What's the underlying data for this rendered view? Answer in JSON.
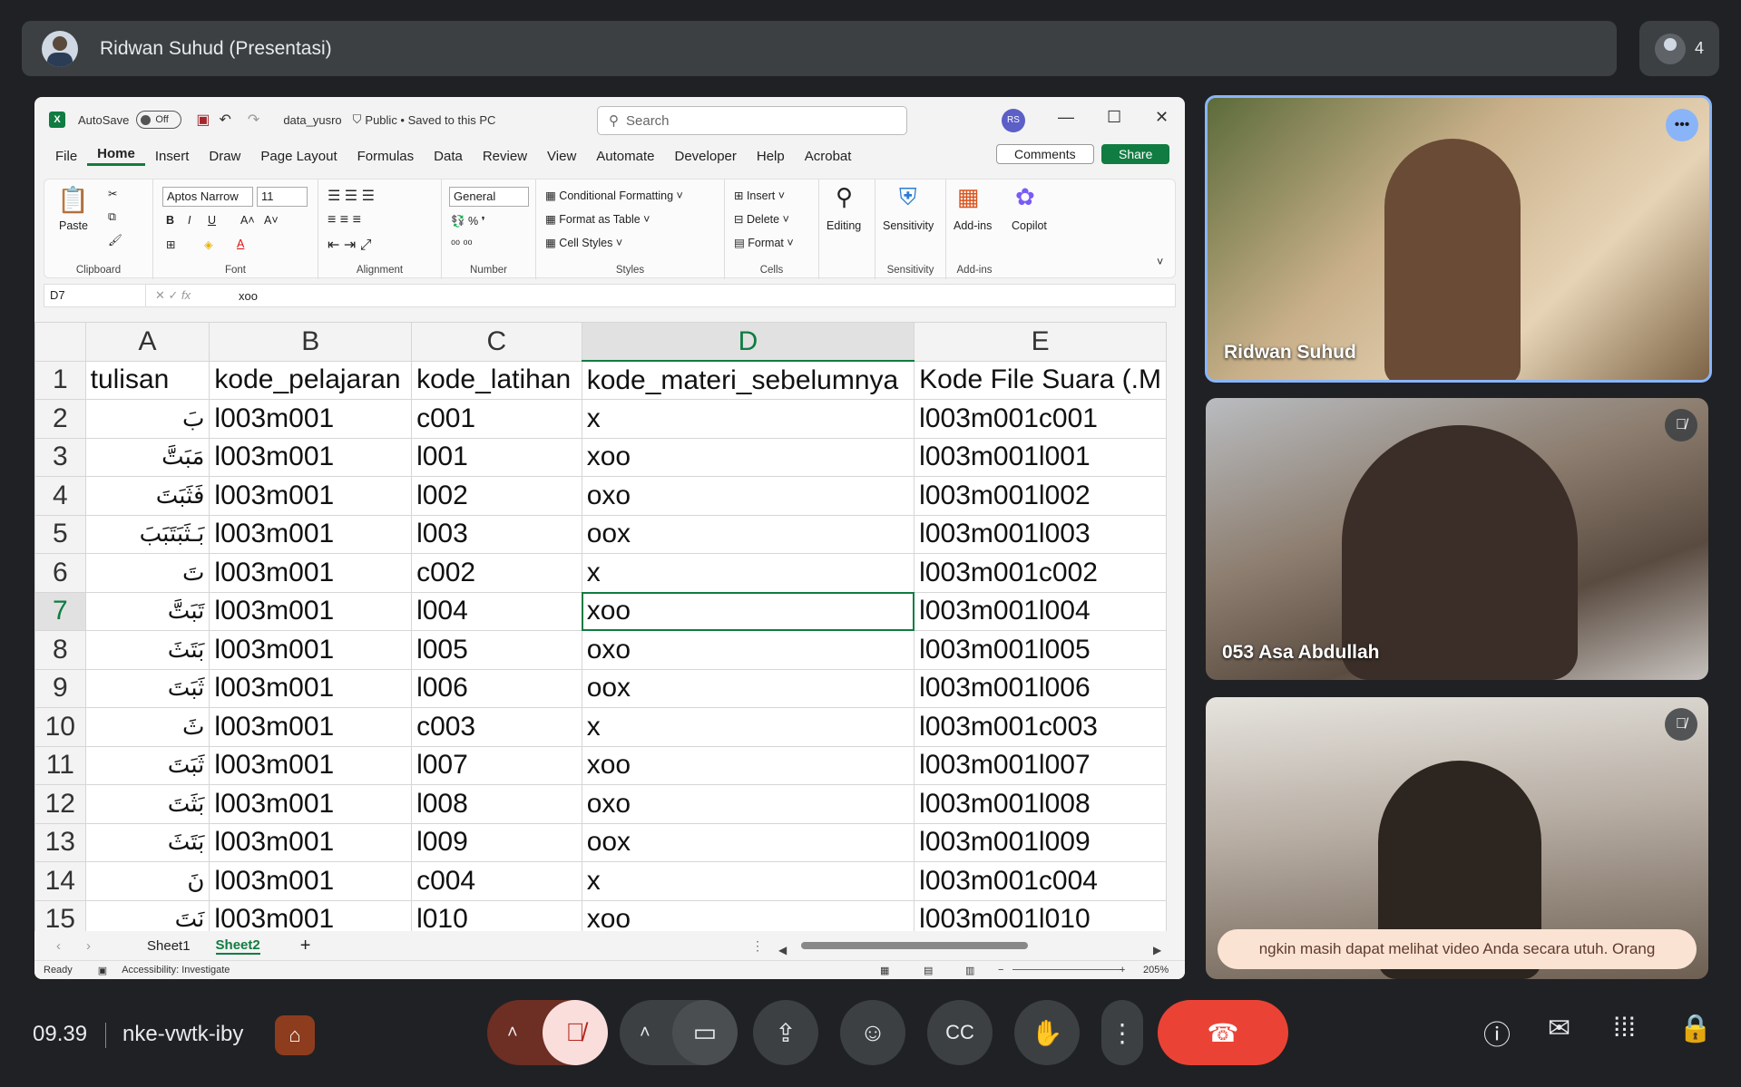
{
  "meet": {
    "presenter_title": "Ridwan Suhud (Presentasi)",
    "participant_count": "4",
    "time": "09.39",
    "meeting_code": "nke-vwtk-iby",
    "caption_text": "ngkin masih dapat melihat video Anda secara utuh. Orang",
    "tiles": [
      {
        "name": "Ridwan Suhud"
      },
      {
        "name": "053 Asa Abdullah"
      },
      {
        "name": ""
      }
    ],
    "colors": {
      "end_call": "#ea4335",
      "mic_muted": "#f9dedc",
      "active_tile_border": "#8ab4f8"
    }
  },
  "excel": {
    "autosave_label": "AutoSave",
    "autosave_state": "Off",
    "file_name": "data_yusro",
    "file_status": "Public • Saved to this PC",
    "search_placeholder": "Search",
    "user_initials": "RS",
    "menu": [
      "File",
      "Home",
      "Insert",
      "Draw",
      "Page Layout",
      "Formulas",
      "Data",
      "Review",
      "View",
      "Automate",
      "Developer",
      "Help",
      "Acrobat"
    ],
    "comments_label": "Comments",
    "share_label": "Share",
    "ribbon": {
      "paste": "Paste",
      "clipboard": "Clipboard",
      "font_name": "Aptos Narrow",
      "font_size": "11",
      "font": "Font",
      "alignment": "Alignment",
      "number_format": "General",
      "number": "Number",
      "conditional_formatting": "Conditional Formatting",
      "format_as_table": "Format as Table",
      "cell_styles": "Cell Styles",
      "styles": "Styles",
      "insert": "Insert",
      "delete": "Delete",
      "format": "Format",
      "cells": "Cells",
      "editing": "Editing",
      "sensitivity": "Sensitivity",
      "sensitivity_group": "Sensitivity",
      "addins": "Add-ins",
      "addins_group": "Add-ins",
      "copilot": "Copilot"
    },
    "name_box": "D7",
    "formula": "xoo",
    "columns": [
      "A",
      "B",
      "C",
      "D",
      "E"
    ],
    "rows": [
      {
        "n": "1",
        "a": "tulisan",
        "b": "kode_pelajaran",
        "c": "kode_latihan",
        "d": "kode_materi_sebelumnya",
        "e": "Kode File Suara (.M"
      },
      {
        "n": "2",
        "a": "بَ",
        "b": "l003m001",
        "c": "c001",
        "d": "x",
        "e": "l003m001c001"
      },
      {
        "n": "3",
        "a": "مَبَتَّ",
        "b": "l003m001",
        "c": "l001",
        "d": "xoo",
        "e": "l003m001l001"
      },
      {
        "n": "4",
        "a": "فَثَبَتَ",
        "b": "l003m001",
        "c": "l002",
        "d": "oxo",
        "e": "l003m001l002"
      },
      {
        "n": "5",
        "a": "بَـثَبَتَبَبَ",
        "b": "l003m001",
        "c": "l003",
        "d": "oox",
        "e": "l003m001l003"
      },
      {
        "n": "6",
        "a": "تَ",
        "b": "l003m001",
        "c": "c002",
        "d": "x",
        "e": "l003m001c002"
      },
      {
        "n": "7",
        "a": "تَبَتَّ",
        "b": "l003m001",
        "c": "l004",
        "d": "xoo",
        "e": "l003m001l004"
      },
      {
        "n": "8",
        "a": "بَتَثَ",
        "b": "l003m001",
        "c": "l005",
        "d": "oxo",
        "e": "l003m001l005"
      },
      {
        "n": "9",
        "a": "ثَبَتَ",
        "b": "l003m001",
        "c": "l006",
        "d": "oox",
        "e": "l003m001l006"
      },
      {
        "n": "10",
        "a": "ثَ",
        "b": "l003m001",
        "c": "c003",
        "d": "x",
        "e": "l003m001c003"
      },
      {
        "n": "11",
        "a": "ثَبَتَ",
        "b": "l003m001",
        "c": "l007",
        "d": "xoo",
        "e": "l003m001l007"
      },
      {
        "n": "12",
        "a": "بَثَتَ",
        "b": "l003m001",
        "c": "l008",
        "d": "oxo",
        "e": "l003m001l008"
      },
      {
        "n": "13",
        "a": "بَتَثَ",
        "b": "l003m001",
        "c": "l009",
        "d": "oox",
        "e": "l003m001l009"
      },
      {
        "n": "14",
        "a": "نَ",
        "b": "l003m001",
        "c": "c004",
        "d": "x",
        "e": "l003m001c004"
      },
      {
        "n": "15",
        "a": "نَتَ",
        "b": "l003m001",
        "c": "l010",
        "d": "xoo",
        "e": "l003m001l010"
      }
    ],
    "sheets": [
      "Sheet1",
      "Sheet2"
    ],
    "active_sheet": "Sheet2",
    "status_ready": "Ready",
    "accessibility": "Accessibility: Investigate",
    "zoom": "205%"
  }
}
